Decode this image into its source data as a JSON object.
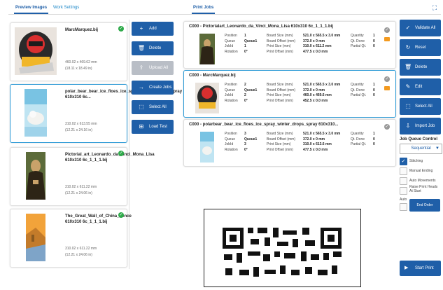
{
  "tabs": {
    "left": [
      {
        "label": "Preview Images"
      },
      {
        "label": "Work Settings"
      }
    ],
    "right": [
      {
        "label": "Print Jobs"
      }
    ]
  },
  "files": [
    {
      "name": "MarcMarquez.bij",
      "dims_mm": "460.02 x 469.62 mm",
      "dims_in": "(18.11 x 18.49 in)"
    },
    {
      "name": "polar_bear_bear_ice_floes_ice_spray_winter_drops_spray 610x310 6c...",
      "dims_mm": "310.02 x 613.55 mm",
      "dims_in": "(12.21 x 24.16 in)"
    },
    {
      "name": "Pictorial_art_Leonardo_da_Vinci_Mona_Lisa 610x310 6c_1_1_1.bij",
      "dims_mm": "310.02 x 611.22 mm",
      "dims_in": "(12.21 x 24.06 in)"
    },
    {
      "name": "The_Great_Wall_of_China_Fence 610x310 6c_1_1_1.bij",
      "dims_mm": "310.02 x 611.22 mm",
      "dims_in": "(12.21 x 24.06 in)"
    }
  ],
  "actions": [
    {
      "label": "Add",
      "icon": "plus-icon"
    },
    {
      "label": "Delete",
      "icon": "trash-icon"
    },
    {
      "label": "Upload All",
      "icon": "upload-icon"
    },
    {
      "label": "Create Jobs",
      "icon": "arrow-right-icon"
    },
    {
      "label": "Select All",
      "icon": "select-all-icon"
    },
    {
      "label": "Load Test",
      "icon": "load-test-icon"
    }
  ],
  "jobs": [
    {
      "title": "C000 - Pictorialart_Leonardo_da_Vinci_Mona_Lisa 610x310 6c_1_1_1.bij",
      "position": "1",
      "queue": "Queue1",
      "jobid": "1",
      "rotation": "0°",
      "board_size": "521.0 x 565.5 x 3.0 mm",
      "board_offset": "372.0 x 0 mm",
      "print_size": "310.0 x 611.2 mm",
      "print_offset": "477.5 x 0.0 mm",
      "quantity": "1",
      "qt_done": "0",
      "partial_qt": "0"
    },
    {
      "title": "C000 - MarcMarquez.bij",
      "position": "2",
      "queue": "Queue1",
      "jobid": "2",
      "rotation": "0°",
      "board_size": "521.0 x 565.5 x 3.0 mm",
      "board_offset": "372.0 x 0 mm",
      "print_size": "460.0 x 469.6 mm",
      "print_offset": "452.5 x 0.0 mm",
      "quantity": "1",
      "qt_done": "0",
      "partial_qt": "0"
    },
    {
      "title": "C000 - polarbear_bear_ice_floes_ice_spray_winter_drops_spray 610x310...",
      "position": "3",
      "queue": "Queue1",
      "jobid": "3",
      "rotation": "0°",
      "board_size": "521.0 x 565.5 x 3.0 mm",
      "board_offset": "372.0 x 0 mm",
      "print_size": "310.0 x 613.6 mm",
      "print_offset": "477.5 x 0.0 mm",
      "quantity": "1",
      "qt_done": "0",
      "partial_qt": "0"
    }
  ],
  "job_labels": {
    "position": "Position",
    "queue": "Queue",
    "jobid": "JobId",
    "rotation": "Rotation",
    "board_size": "Board Size (mm)",
    "board_offset": "Board Offset (mm)",
    "print_size": "Print Size (mm)",
    "print_offset": "Print Offset (mm)",
    "quantity": "Quantity",
    "qt_done": "Qt. Done",
    "partial_qt": "Partial Qt."
  },
  "controls": [
    {
      "label": "Validate All",
      "icon": "check-icon"
    },
    {
      "label": "Reset",
      "icon": "reset-icon"
    },
    {
      "label": "Delete",
      "icon": "trash-icon"
    },
    {
      "label": "Edit",
      "icon": "pencil-icon"
    },
    {
      "label": "Select All",
      "icon": "select-all-icon"
    },
    {
      "label": "Import Job",
      "icon": "import-icon"
    }
  ],
  "queue": {
    "label": "Job Queue Control",
    "selected": "Sequential"
  },
  "options": [
    {
      "label": "Stitching",
      "checked": true
    },
    {
      "label": "Manual Ending",
      "checked": false
    },
    {
      "label": "Auto Movements",
      "checked": false
    },
    {
      "label": "Raise Print Heads At Start",
      "checked": false
    }
  ],
  "auto_label": "Auto",
  "end_order": "End Order",
  "start_print": "Start Print",
  "colors": {
    "primary": "#1f5fa8",
    "selected_border": "#2d9ad6",
    "ok": "#2eaa4a",
    "folder": "#f39a1f"
  }
}
